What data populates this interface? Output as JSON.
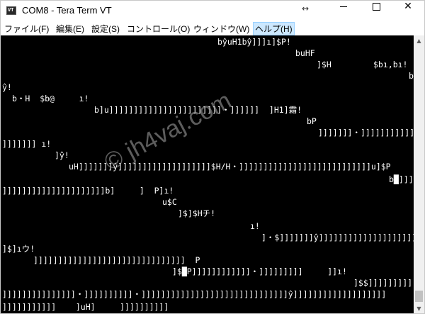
{
  "window": {
    "title": "COM8 - Tera Term VT",
    "app_icon_text": "VT",
    "resize_icon": "↔",
    "buttons": {
      "minimize": "minimize-icon",
      "maximize": "maximize-icon",
      "close": "✕"
    }
  },
  "menu": {
    "items": [
      {
        "label": "ファイル(F)"
      },
      {
        "label": "編集(E)"
      },
      {
        "label": "設定(S)"
      },
      {
        "label": "コントロール(O)"
      },
      {
        "label": "ウィンドウ(W)"
      },
      {
        "label": "ヘルプ(H)"
      }
    ]
  },
  "terminal": {
    "lines": [
      {
        "text": "bŷuH1bŷ]]]ı]$P!"
      },
      {
        "text": "buHF"
      },
      {
        "text": "]$H"
      },
      {
        "text": "$bı,bı!"
      },
      {
        "text": "b"
      },
      {
        "text": "ŷ!"
      },
      {
        "text": "b・H  $b@     ı!"
      },
      {
        "text": "b]u]]]]]]]]]]]]]]]]]]]]]]]・]]]]]]  ]H1]霜!"
      },
      {
        "text": "bP"
      },
      {
        "text": "]]]]]]]・]]]]]]]]]]]]]]]]]"
      },
      {
        "text": "]]]]]]] ı!"
      },
      {
        "text": "]ŷ!"
      },
      {
        "text": "uH]]]]]]]ŷ]]]]]]]]]]]]]]]]]]]$H/H・]]]]]]]]]]]]]]]]]]]]]]]]]]]u]$P"
      },
      {
        "text": "b█]]]"
      },
      {
        "text": "]]]]]]]]]]]]]]]]]]]]]b]     ]  P]ı!"
      },
      {
        "text": "u$C"
      },
      {
        "text": "]$]$Hチ!"
      },
      {
        "text": "ı!"
      },
      {
        "text": "]・$]]]]]]]ŷ]]]]]]]]]]]]]]]]]]]]]]"
      },
      {
        "text": "]$]ıウ!"
      },
      {
        "text": "]]]]]]]]]]]]]]]]]]]]]]]]]]]]]]]  P"
      },
      {
        "text": "]$█P]]]]]]]]]]]]・]]]]]]]]]     ]]ı!"
      },
      {
        "text": "]$$]]]]]]]]]]]"
      },
      {
        "text": "]]]]]]]]]]]]]]]・]]]]]]]]]]・]]]]]]]]]]]]]]]]]]]]]]]]]]]]]]ŷ]]]]]]]]]]]]]]]]]]]"
      },
      {
        "text": "]]]]]]]]]]]    ]uH]     ]]]]]]]]]]"
      }
    ]
  },
  "watermark": "© jh4vaj.com",
  "scrollbar": {
    "up": "▲",
    "down": "▼"
  }
}
